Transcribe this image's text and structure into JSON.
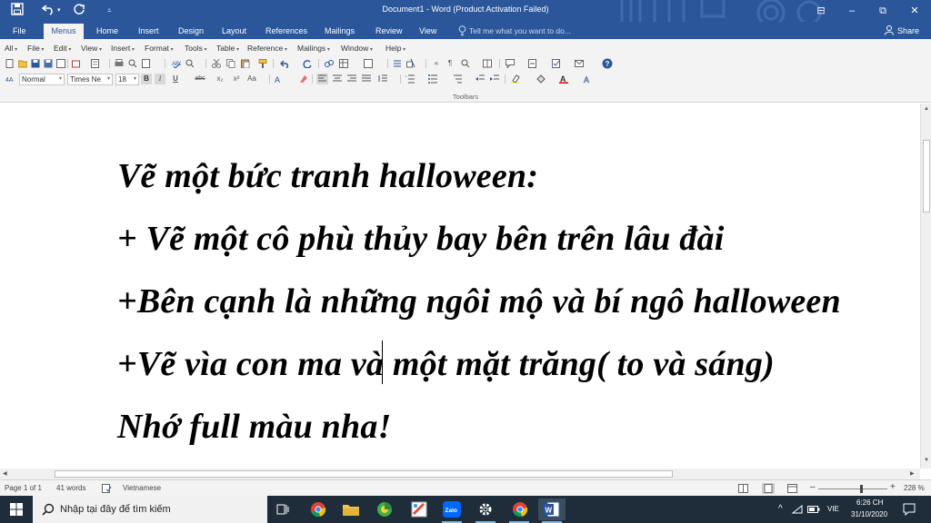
{
  "window": {
    "title": "Document1 - Word (Product Activation Failed)",
    "controls": [
      "⊟",
      "–",
      "⧉",
      "✕"
    ]
  },
  "ribbon": {
    "tabs": [
      "File",
      "Menus",
      "Home",
      "Insert",
      "Design",
      "Layout",
      "References",
      "Mailings",
      "Review",
      "View"
    ],
    "active_tab": "Menus",
    "tell_me": "Tell me what you want to do...",
    "share": "Share"
  },
  "menubar": {
    "items": [
      "All",
      "File",
      "Edit",
      "View",
      "Insert",
      "Format",
      "Tools",
      "Table",
      "Reference",
      "Mailings",
      "Window",
      "Help"
    ]
  },
  "toolbar": {
    "style": "Normal",
    "font": "Times Ne",
    "size": "18",
    "bold": "B",
    "italic": "I",
    "underline": "U",
    "strike": "abc",
    "subscript": "x₂",
    "superscript": "x²",
    "case": "Aa",
    "pilcrow": "¶",
    "label": "Toolbars"
  },
  "document": {
    "lines": [
      "Vẽ một bức tranh halloween:",
      "+ Vẽ một cô phù thủy bay bên trên lâu đài",
      "+Bên cạnh là những ngôi mộ và bí ngô halloween",
      "+Vẽ vìa con ma và một mặt trăng( to và sáng)",
      "Nhớ full màu nha!"
    ]
  },
  "statusbar": {
    "page": "Page 1 of 1",
    "words": "41 words",
    "language": "Vietnamese",
    "zoom": "228 %",
    "zoom_minus": "–",
    "zoom_plus": "+"
  },
  "taskbar": {
    "search_placeholder": "Nhập tại đây để tìm kiếm",
    "zalo": "Zalo",
    "word_letter": "W",
    "language": "VIE",
    "time": "6:26 CH",
    "date": "31/10/2020",
    "tray_up": "^"
  },
  "colors": {
    "word_blue": "#2b579a",
    "taskbar": "#1f2d3a",
    "chrome_red": "#db4437",
    "chrome_yellow": "#f4c20d",
    "chrome_green": "#0f9d58",
    "chrome_blue": "#4285f4"
  },
  "icons": [
    "save-icon",
    "undo-icon",
    "redo-icon",
    "customize-icon",
    "lightbulb-icon",
    "person-icon",
    "help-icon",
    "windows-start-icon",
    "search-icon",
    "task-view-icon",
    "chrome-icon",
    "file-explorer-icon",
    "app-icon",
    "paint-icon",
    "zalo-icon",
    "settings-icon",
    "word-icon",
    "notification-icon",
    "wifi-icon",
    "battery-icon"
  ]
}
